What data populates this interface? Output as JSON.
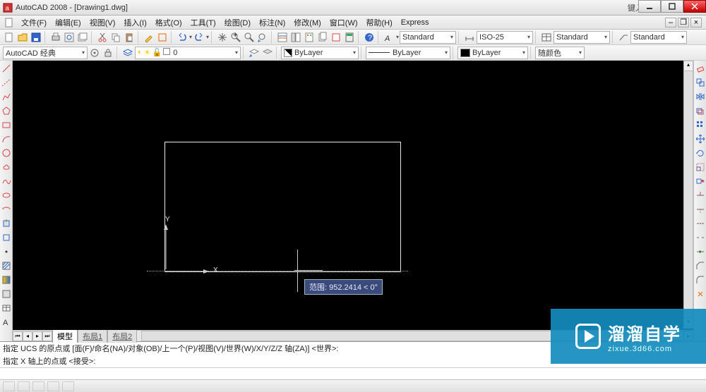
{
  "title": "AutoCAD 2008 - [Drawing1.dwg]",
  "help_hint": "键入问题以获取帮助",
  "menu": [
    "文件(F)",
    "编辑(E)",
    "视图(V)",
    "插入(I)",
    "格式(O)",
    "工具(T)",
    "绘图(D)",
    "标注(N)",
    "修改(M)",
    "窗口(W)",
    "帮助(H)",
    "Express"
  ],
  "toolbar1": {
    "workspace_dd": "AutoCAD 经典",
    "textstyle_dd": "Standard",
    "dimstyle_dd": "ISO-25",
    "tablestyle_dd": "Standard",
    "mleader_dd": "Standard"
  },
  "toolbar2": {
    "layer_dd": "0",
    "color_dd": "ByLayer",
    "linetype_dd": "ByLayer",
    "lineweight_dd": "ByLayer",
    "plotstyle_dd": "随颜色"
  },
  "canvas": {
    "ucs_y": "Y",
    "ucs_x": "X",
    "tooltip": "范围: 952.2414 < 0°"
  },
  "tabs": {
    "model": "模型",
    "layout1": "布局1",
    "layout2": "布局2"
  },
  "cmd": {
    "line1": "指定 UCS 的原点或 [面(F)/命名(NA)/对象(OB)/上一个(P)/视图(V)/世界(W)/X/Y/Z/Z 轴(ZA)] <世界>:",
    "line2": "指定 X 轴上的点或 <接受>:"
  },
  "watermark": {
    "cn": "溜溜自学",
    "en": "zixue.3d66.com"
  }
}
